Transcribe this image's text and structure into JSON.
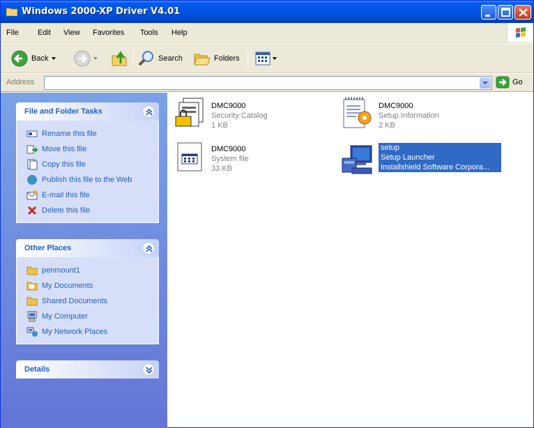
{
  "window": {
    "title": "Windows 2000-XP Driver V4.01"
  },
  "menu": [
    "File",
    "Edit",
    "View",
    "Favorites",
    "Tools",
    "Help"
  ],
  "toolbar": {
    "back_label": "Back",
    "search_label": "Search",
    "folders_label": "Folders"
  },
  "address": {
    "label": "Address",
    "value": "",
    "go_label": "Go"
  },
  "tasks_panel": {
    "title": "File and Folder Tasks",
    "items": [
      {
        "label": "Rename this file",
        "icon": "rename-icon"
      },
      {
        "label": "Move this file",
        "icon": "move-icon"
      },
      {
        "label": "Copy this file",
        "icon": "copy-icon"
      },
      {
        "label": "Publish this file to the Web",
        "icon": "globe-icon"
      },
      {
        "label": "E-mail this file",
        "icon": "email-icon"
      },
      {
        "label": "Delete this file",
        "icon": "delete-icon"
      }
    ]
  },
  "places_panel": {
    "title": "Other Places",
    "items": [
      {
        "label": "penmount1",
        "icon": "folder-icon"
      },
      {
        "label": "My Documents",
        "icon": "folder-icon"
      },
      {
        "label": "Shared Documents",
        "icon": "folder-icon"
      },
      {
        "label": "My Computer",
        "icon": "computer-icon"
      },
      {
        "label": "My Network Places",
        "icon": "network-icon"
      }
    ]
  },
  "details_panel": {
    "title": "Details"
  },
  "files": [
    {
      "name": "DMC9000",
      "type": "Security Catalog",
      "detail": "1 KB",
      "icon": "security-catalog-icon",
      "selected": false
    },
    {
      "name": "DMC9000",
      "type": "Setup Information",
      "detail": "2 KB",
      "icon": "setup-information-icon",
      "selected": false
    },
    {
      "name": "DMC9000",
      "type": "System file",
      "detail": "33 KB",
      "icon": "system-file-icon",
      "selected": false
    },
    {
      "name": "setup",
      "type": "Setup Launcher",
      "detail": "Installshield Software Corpora...",
      "icon": "setup-launcher-icon",
      "selected": true
    }
  ],
  "colors": {
    "titlebar": "#0054e3",
    "taskpane_bg": "#6375d6",
    "link": "#215dc6",
    "selection": "#316ac5"
  }
}
